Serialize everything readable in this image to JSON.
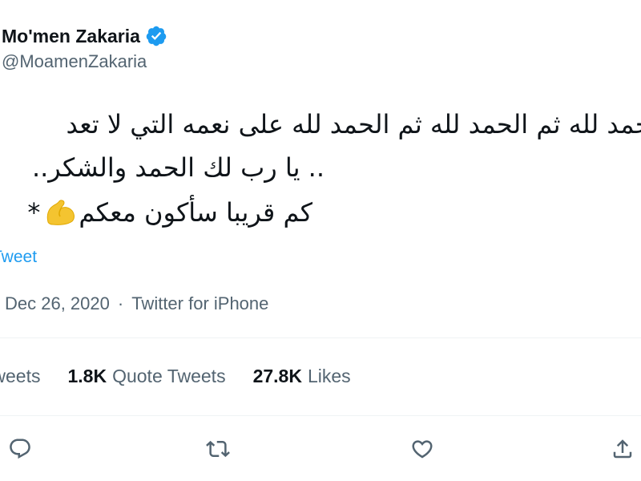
{
  "author": {
    "name": "Mo'men Zakaria",
    "handle": "@MoamenZakaria",
    "verified_icon": "verified-badge-icon",
    "verified_color": "#1d9bf0"
  },
  "tweet": {
    "line1": "الحمد لله ثم الحمد لله ثم الحمد لله على نعمه التي لا تعد",
    "line2": ".. يا رب لك الحمد والشكر..",
    "line3_text": "وحشتوني كثيراً سأكون معكم قريبا سأكون معكم",
    "line3_visible": "كم قريبا سأكون معكم",
    "line3_emoji": "flexed-biceps-emoji",
    "line3_suffix": "*"
  },
  "translate_label": "Tweet",
  "meta": {
    "date": "Dec 26, 2020",
    "separator": "·",
    "source": "Twitter for iPhone"
  },
  "stats": {
    "retweets_label": "tweets",
    "quote_count": "1.8K",
    "quote_label": "Quote Tweets",
    "likes_count": "27.8K",
    "likes_label": "Likes"
  },
  "actions": {
    "reply_icon": "reply-icon",
    "retweet_icon": "retweet-icon",
    "like_icon": "heart-icon",
    "share_icon": "share-icon"
  },
  "colors": {
    "text_primary": "#0f1419",
    "text_secondary": "#536471",
    "link": "#1d9bf0",
    "divider": "#eff3f4"
  }
}
